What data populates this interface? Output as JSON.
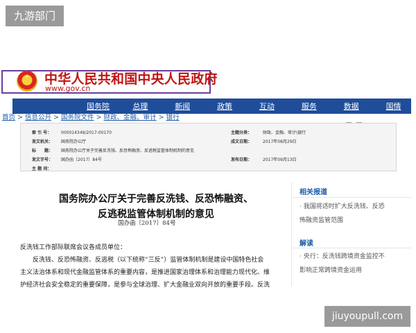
{
  "watermarks": {
    "top_label": "九游部门",
    "bottom_label": "jiuyoupull.com"
  },
  "header": {
    "title": "中华人民共和国中央人民政府",
    "url": "www.gov.cn"
  },
  "nav": [
    "国务院",
    "总理",
    "新闻",
    "政策",
    "互动",
    "服务",
    "数据",
    "国情"
  ],
  "breadcrumb": {
    "home": "首页",
    "info": "信息公开",
    "files": "国务院文件",
    "category": "财政、金融、审计",
    "bank": "银行",
    "sep": " > "
  },
  "meta": {
    "index_key": "索 引 号：",
    "index_val": "000014349/2017-00170",
    "classify_key": "主题分类：",
    "classify_val": "财政、金融、审计\\银行",
    "org_key": "发文机关：",
    "org_val": "国务院办公厅",
    "date_key": "成文日期：",
    "date_val": "2017年08月29日",
    "title_key": "标　　题：",
    "title_val": "国务院办公厅关于完善反洗钱、反恐怖融资、反逃税监管体制机制的意见",
    "docno_key": "发文字号：",
    "docno_val": "国办函〔2017〕84号",
    "pub_key": "发布日期：",
    "pub_val": "2017年09月13日",
    "keyword_key": "主 题 词："
  },
  "doc": {
    "title_line1": "国务院办公厅关于完善反洗钱、反恐怖融资、",
    "title_line2": "反逃税监管体制机制的意见",
    "doc_no": "国办函〔2017〕84号",
    "salutation": "反洗钱工作部际联席会议各成员单位：",
    "para1_l1": "反洗钱、反恐怖融资、反逃税（以下统称“三反”）监管体制机制是建设中国特色社会",
    "para1_l2": "主义法治体系和现代金融监管体系的重要内容，是推进国家治理体系和治理能力现代化、维",
    "para1_l3": "护经济社会安全稳定的重要保障，是参与全球治理、扩大金融业双向开放的重要手段。反洗"
  },
  "sidebar": {
    "related_heading": "相关报道",
    "related_l1": "· 我国将适时扩大反洗钱、反恐",
    "related_l2": "怖融资监管范围",
    "interpret_heading": "解读",
    "interpret_l1": "· 央行：反洗钱跨境资金监控不",
    "interpret_l2": "影响正常跨境资金运用"
  },
  "colors": {
    "nav_bg": "#1f4d9a",
    "title_red": "#c01512",
    "link_blue": "#1e5aa8"
  },
  "icons": {
    "emblem": "national-emblem-icon",
    "share": "plus-icon",
    "font_size": "text-size-icon"
  }
}
